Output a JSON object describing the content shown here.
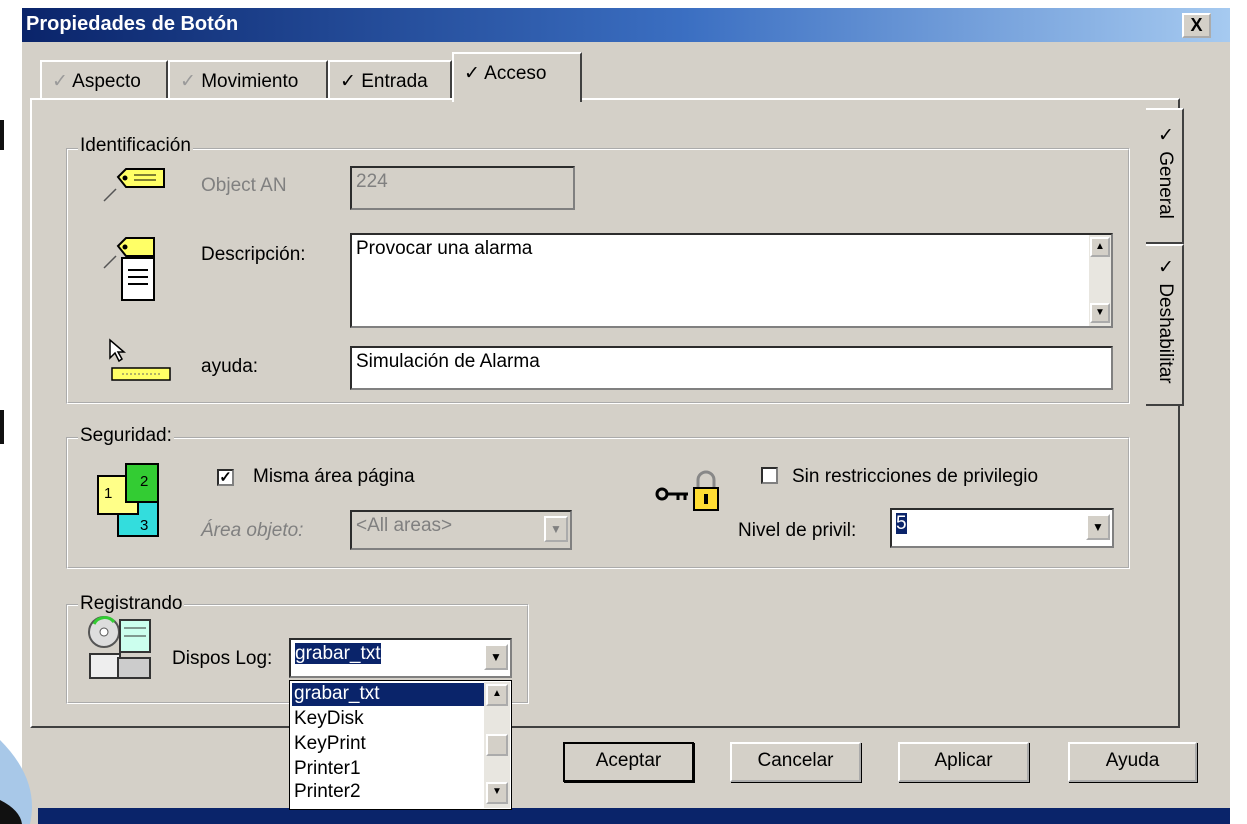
{
  "window": {
    "title": "Propiedades de Botón",
    "close": "X"
  },
  "tabs": [
    {
      "label": "Aspecto",
      "check": "✓",
      "active": false
    },
    {
      "label": "Movimiento",
      "check": "✓",
      "active": false
    },
    {
      "label": "Entrada",
      "check": "✓",
      "active": false
    },
    {
      "label": "Acceso",
      "check": "✓",
      "active": true
    }
  ],
  "side_tabs": [
    {
      "label": "✓ General",
      "active": true
    },
    {
      "label": "✓ Deshabilitar",
      "active": false
    }
  ],
  "identificacion": {
    "legend": "Identificación",
    "object_label": "Object AN",
    "object_value": "224",
    "desc_label": "Descripción:",
    "desc_value": "Provocar una alarma",
    "help_label": "ayuda:",
    "help_value": "Simulación de Alarma"
  },
  "seguridad": {
    "legend": "Seguridad:",
    "same_area_label": "Misma área página",
    "same_area_checked": true,
    "area_label": "Área objeto:",
    "area_value": "<All areas>",
    "norestrict_label": "Sin restricciones de privilegio",
    "norestrict_checked": false,
    "level_label": "Nivel de privil:",
    "level_value": "5",
    "area_icon_nums": [
      "1",
      "2",
      "3"
    ]
  },
  "registrando": {
    "legend": "Registrando",
    "log_label": "Dispos Log:",
    "log_value": "grabar_txt",
    "options": [
      "grabar_txt",
      "KeyDisk",
      "KeyPrint",
      "Printer1",
      "Printer2"
    ]
  },
  "buttons": {
    "ok": "Aceptar",
    "cancel": "Cancelar",
    "apply": "Aplicar",
    "help": "Ayuda"
  },
  "colors": {
    "title_start": "#0a246a",
    "title_end": "#a6caf0",
    "face": "#d4d0c8",
    "highlight": "#0a246a"
  }
}
